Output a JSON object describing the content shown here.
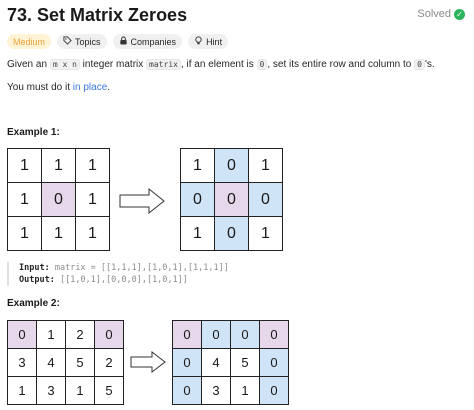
{
  "header": {
    "title": "73. Set Matrix Zeroes",
    "solved_label": "Solved"
  },
  "tags": [
    {
      "label": "Medium",
      "icon": ""
    },
    {
      "label": "Topics",
      "icon": "tag-icon"
    },
    {
      "label": "Companies",
      "icon": "lock-icon"
    },
    {
      "label": "Hint",
      "icon": "lightbulb-icon"
    }
  ],
  "description": {
    "p1_a": "Given an ",
    "p1_code1": "m x n",
    "p1_b": " integer matrix ",
    "p1_code2": "matrix",
    "p1_c": ", if an element is ",
    "p1_code3": "0",
    "p1_d": ", set its entire row and column to ",
    "p1_code4": "0",
    "p1_e": "'s.",
    "p2_a": "You must do it ",
    "p2_link": "in place",
    "p2_b": "."
  },
  "examples": [
    {
      "title": "Example 1:",
      "input_matrix": [
        [
          "1",
          "1",
          "1"
        ],
        [
          "1",
          "0",
          "1"
        ],
        [
          "1",
          "1",
          "1"
        ]
      ],
      "output_matrix": [
        [
          "1",
          "0",
          "1"
        ],
        [
          "0",
          "0",
          "0"
        ],
        [
          "1",
          "0",
          "1"
        ]
      ],
      "input_label": "Input:",
      "input_value": "matrix = [[1,1,1],[1,0,1],[1,1,1]]",
      "output_label": "Output:",
      "output_value": "[[1,0,1],[0,0,0],[1,0,1]]"
    },
    {
      "title": "Example 2:",
      "input_matrix": [
        [
          "0",
          "1",
          "2",
          "0"
        ],
        [
          "3",
          "4",
          "5",
          "2"
        ],
        [
          "1",
          "3",
          "1",
          "5"
        ]
      ],
      "output_matrix": [
        [
          "0",
          "0",
          "0",
          "0"
        ],
        [
          "0",
          "4",
          "5",
          "0"
        ],
        [
          "0",
          "3",
          "1",
          "0"
        ]
      ]
    }
  ],
  "colors": {
    "highlight_zero": "#e6d8ea",
    "highlight_affected": "#cfe4f7",
    "medium_text": "#e6a33a",
    "solved_check": "#2db55d",
    "link": "#3a7ad9"
  }
}
